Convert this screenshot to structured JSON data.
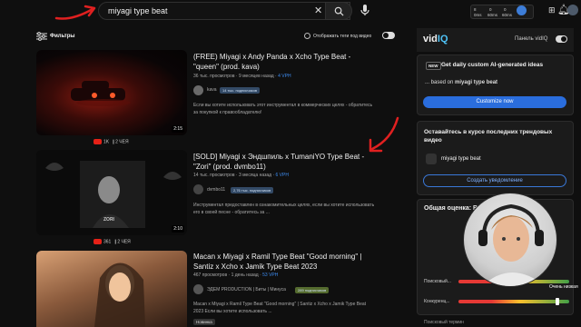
{
  "search": {
    "query": "miyagi type beat"
  },
  "topbar": {
    "ext_stats": [
      {
        "value": "8",
        "label": "0ms"
      },
      {
        "value": "0",
        "label": "60ms"
      },
      {
        "value": "0",
        "label": "60ms"
      }
    ]
  },
  "filters": {
    "label": "Фильтры",
    "tags_toggle_label": "Отображать теги под видео"
  },
  "videos": [
    {
      "title": "(FREE) Miyagi x Andy Panda x Xcho Type Beat - \"queen\" (prod. kava)",
      "views": "36 тыс. просмотров",
      "age": "9 месяцев назад",
      "vph": "4 VPH",
      "channel": "kava",
      "subs": "14 тыс. подписчиков",
      "description": "Если вы хотите использовать этот инструментал в коммерческих целях - обратитесь за покупкой к правообладателю!",
      "duration": "2:15",
      "likes": "1K",
      "comments": "2 ЧЕЯ"
    },
    {
      "title": "[SOLD] Miyagi x Эндшпиль x TumaniYO Type Beat - \"Zori\" (prod. dvmbo11)",
      "views": "14 тыс. просмотров",
      "age": "3 месяца назад",
      "vph": "6 VPH",
      "channel": "dvmbo11",
      "subs": "2,76 тыс. подписчиков",
      "description": "Инструментал предоставлен в ознакомительных целях, если вы хотите использовать его в своей песне - обратитесь за ...",
      "duration": "2:10",
      "likes": "361",
      "comments": "2 ЧЕЯ"
    },
    {
      "title": "Macan x Miyagi x Ramil Type Beat \"Good morning\" | Santiz x Xcho x Jamik Type Beat 2023",
      "views": "467 просмотров",
      "age": "1 день назад",
      "vph": "53 VPH",
      "channel": "ЭДЕМ PRODUCTION | Биты | Минуса",
      "subs": "289 подписчиков",
      "description": "Macan x Miyagi x Ramil Type Beat \"Good morning\" | Santiz x Xcho x Jamik Type Beat 2023 Если вы хотите использовать ...",
      "badge": "Новинка"
    }
  ],
  "vidiq": {
    "logo": "vid",
    "logo_accent": "IQ",
    "panel_label": "Панель vidIQ",
    "ideas_badge": "NEW",
    "ideas_title": "Get daily custom AI-generated ideas",
    "ideas_sub_prefix": "... based on ",
    "ideas_sub_term": "miyagi type beat",
    "customize_label": "Customize now",
    "alert_title": "Оставайтесь в курсе последних трендовых видео",
    "tag_chip": "miyagi type beat",
    "alert_button": "Создать уведомление",
    "score_title": "Общая оценка: В",
    "row1_label": "Поисковый...",
    "row2_label": "Конкуренц...",
    "very_low": "Очень низкая",
    "search_term_label": "Поисковый термин"
  }
}
